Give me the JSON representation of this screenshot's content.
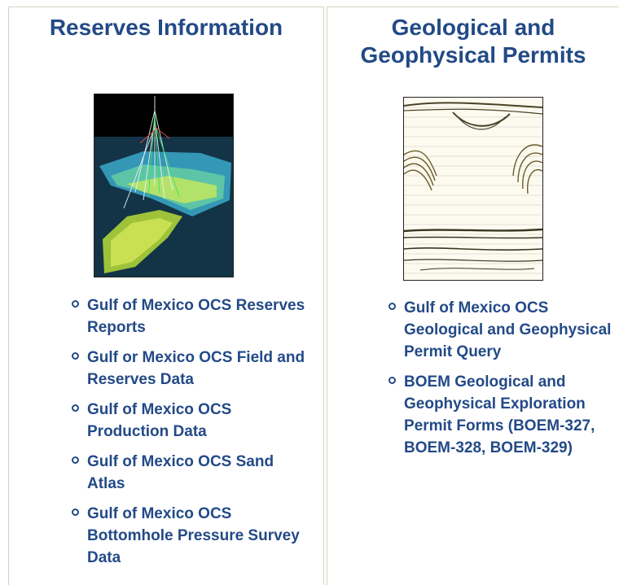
{
  "left_panel": {
    "title": "Reserves Information",
    "image_icon": "3d-reservoir-model-image",
    "links": [
      {
        "label": "Gulf of Mexico OCS Reserves Reports"
      },
      {
        "label": "Gulf or Mexico OCS Field and Reserves Data"
      },
      {
        "label": "Gulf of Mexico OCS Production Data"
      },
      {
        "label": "Gulf of Mexico OCS Sand Atlas"
      },
      {
        "label": "Gulf of Mexico OCS Bottomhole Pressure Survey Data"
      }
    ]
  },
  "right_panel": {
    "title": "Geological and Geophysical Permits",
    "image_icon": "seismic-section-image",
    "links": [
      {
        "label": "Gulf of Mexico OCS Geological and Geophysical Permit Query"
      },
      {
        "label": "BOEM Geological and Geophysical Exploration Permit Forms (BOEM-327, BOEM-328, BOEM-329)"
      }
    ]
  },
  "colors": {
    "link": "#234a87",
    "panel_border": "#d6d2bf"
  }
}
